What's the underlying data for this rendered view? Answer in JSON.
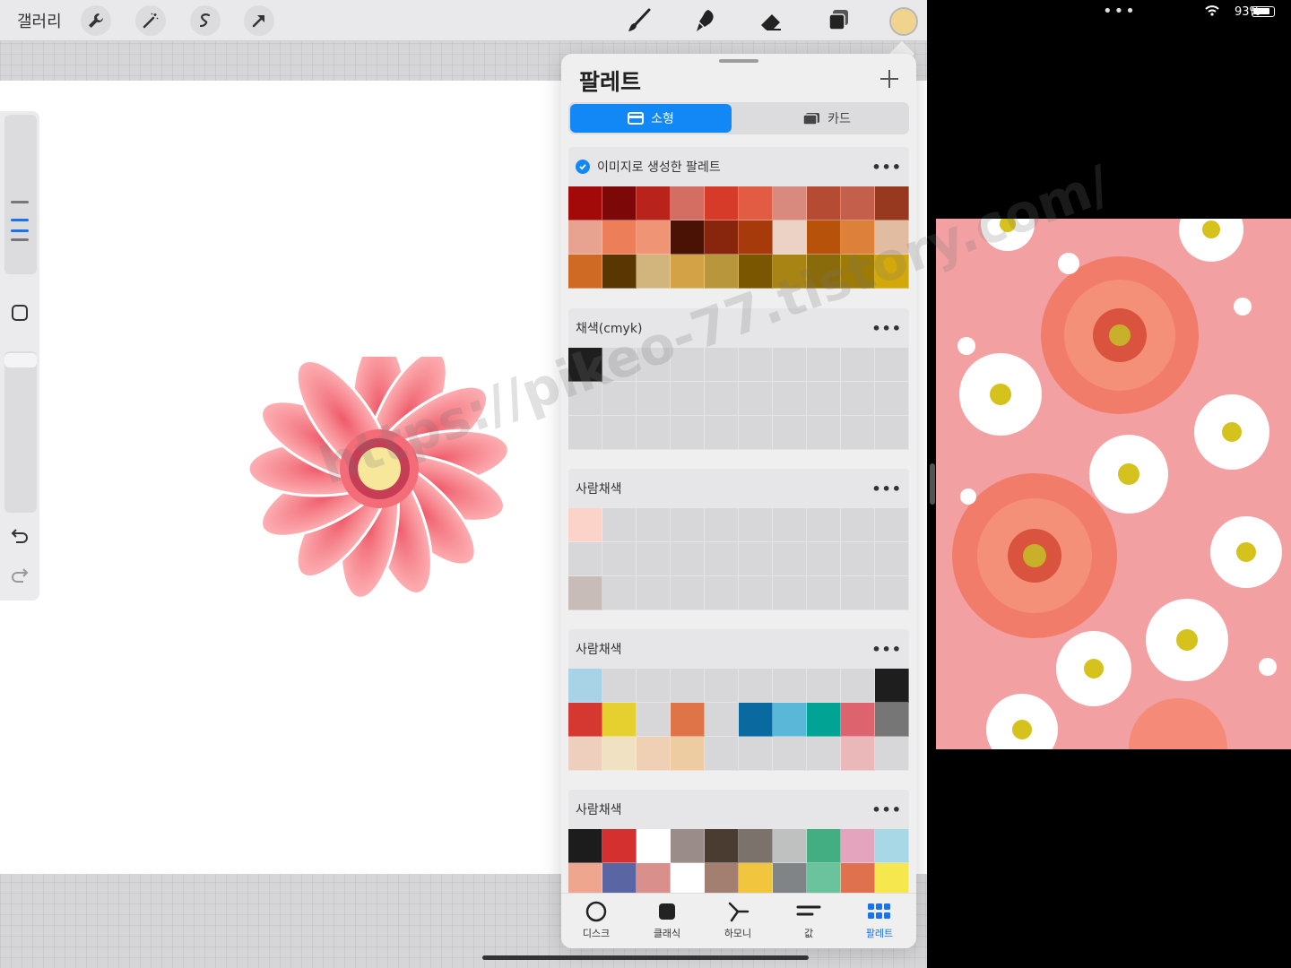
{
  "toolbar": {
    "gallery_label": "갤러리",
    "current_color": "#f0d48e"
  },
  "watermark": "https://pikeo-77.tistory.com/",
  "palette_panel": {
    "title": "팔레트",
    "view_tabs": [
      {
        "label": "소형",
        "active": true
      },
      {
        "label": "카드",
        "active": false
      }
    ],
    "palettes": [
      {
        "name": "이미지로 생성한 팔레트",
        "default": true,
        "rows": [
          [
            "#a20a0a",
            "#7d0808",
            "#b8231c",
            "#d46e63",
            "#d63b2a",
            "#e25c44",
            "#d98a7e",
            "#b64b34",
            "#c35f4b",
            "#97391f"
          ],
          [
            "#e8a390",
            "#ec7f5a",
            "#ef9474",
            "#4a1204",
            "#87260c",
            "#a63a0a",
            "#ecd2c4",
            "#b7520b",
            "#dd813a",
            "#e1bca0"
          ],
          [
            "#ce6a23",
            "#5a3602",
            "#d1b57c",
            "#d3a146",
            "#b7963c",
            "#7a5600",
            "#a88415",
            "#8a6b0c",
            "#9e7b05",
            "#d2a80a"
          ]
        ]
      },
      {
        "name": "채색(cmyk)",
        "default": false,
        "rows": [
          [
            "#1e1e1e",
            "",
            "",
            "",
            "",
            "",
            "",
            "",
            "",
            ""
          ],
          [
            "",
            "",
            "",
            "",
            "",
            "",
            "",
            "",
            "",
            ""
          ],
          [
            "",
            "",
            "",
            "",
            "",
            "",
            "",
            "",
            "",
            ""
          ]
        ]
      },
      {
        "name": "사람채색",
        "default": false,
        "rows": [
          [
            "#fbd3c9",
            "",
            "",
            "",
            "",
            "",
            "",
            "",
            "",
            ""
          ],
          [
            "",
            "",
            "",
            "",
            "",
            "",
            "",
            "",
            "",
            ""
          ],
          [
            "#c8bcb8",
            "",
            "",
            "",
            "",
            "",
            "",
            "",
            "",
            ""
          ]
        ]
      },
      {
        "name": "사람채색",
        "default": false,
        "rows": [
          [
            "#a8d3e6",
            "",
            "",
            "",
            "",
            "",
            "",
            "",
            "",
            "#1e1e1e"
          ],
          [
            "#d53731",
            "#e6d030",
            "",
            "#e07449",
            "",
            "#0a6aa0",
            "#5ab7d8",
            "#00a394",
            "#dd636e",
            "#767676"
          ],
          [
            "#eecfbe",
            "#f1e1c3",
            "#efd0b4",
            "#eecca2",
            "",
            "",
            "",
            "",
            "#eab8b8",
            ""
          ]
        ]
      },
      {
        "name": "사람채색",
        "default": false,
        "rows": [
          [
            "#1c1c1c",
            "#d3302f",
            "#ffffff",
            "#9a8d89",
            "#4a3c31",
            "#7b726b",
            "#bfc0c0",
            "#43ae82",
            "#e5a4bd",
            "#a8d7e6"
          ],
          [
            "#eea68f",
            "#5a66a4",
            "#d98f8b",
            "#ffffff",
            "#a37f71",
            "#f2c53e",
            "#808487",
            "#6bc39e",
            "#e0714e",
            "#f5e74d"
          ]
        ]
      }
    ],
    "bottom_tabs": [
      {
        "label": "디스크",
        "icon": "disc-icon"
      },
      {
        "label": "클래식",
        "icon": "classic-square-icon"
      },
      {
        "label": "하모니",
        "icon": "harmony-icon"
      },
      {
        "label": "값",
        "icon": "value-sliders-icon"
      },
      {
        "label": "팔레트",
        "icon": "palette-grid-icon",
        "active": true
      }
    ]
  },
  "status_bar": {
    "battery_percent": "93%"
  },
  "colors": {
    "accent": "#1288f7",
    "empty_swatch": "#d7d7d9"
  }
}
